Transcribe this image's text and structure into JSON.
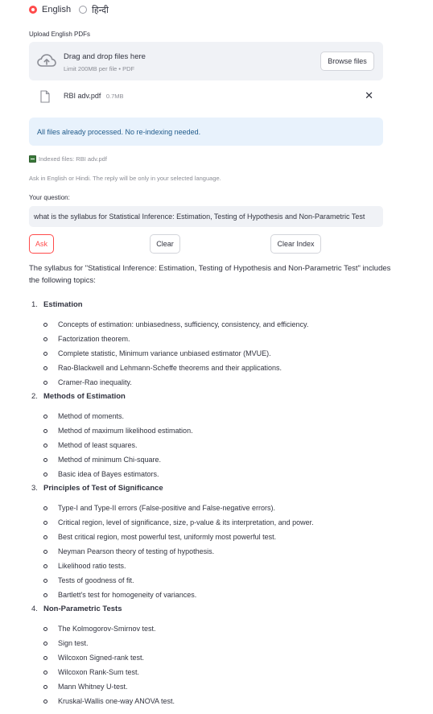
{
  "language": {
    "options": [
      {
        "label": "English",
        "selected": true
      },
      {
        "label": "हिन्दी",
        "selected": false
      }
    ]
  },
  "uploader": {
    "label": "Upload English PDFs",
    "drop_title": "Drag and drop files here",
    "drop_sub": "Limit 200MB per file • PDF",
    "browse_label": "Browse files",
    "file": {
      "name": "RBI adv.pdf",
      "size": "0.7MB"
    },
    "close_glyph": "✕"
  },
  "info": {
    "message": "All files already processed. No re-indexing needed."
  },
  "indexed": {
    "text": "Indexed files: RBI adv.pdf"
  },
  "caption": "Ask in English or Hindi. The reply will be only in your selected language.",
  "question": {
    "label": "Your question:",
    "value": "what is the syllabus for Statistical Inference: Estimation, Testing of Hypothesis and Non-Parametric Test"
  },
  "buttons": {
    "ask": "Ask",
    "clear": "Clear",
    "clear_index": "Clear Index"
  },
  "answer": {
    "intro": "The syllabus for \"Statistical Inference: Estimation, Testing of Hypothesis and Non-Parametric Test\" includes the following topics:",
    "sections": [
      {
        "num": "1.",
        "title": "Estimation",
        "items": [
          "Concepts of estimation: unbiasedness, sufficiency, consistency, and efficiency.",
          "Factorization theorem.",
          "Complete statistic, Minimum variance unbiased estimator (MVUE).",
          "Rao-Blackwell and Lehmann-Scheffe theorems and their applications.",
          "Cramer-Rao inequality."
        ]
      },
      {
        "num": "2.",
        "title": "Methods of Estimation",
        "items": [
          "Method of moments.",
          "Method of maximum likelihood estimation.",
          "Method of least squares.",
          "Method of minimum Chi-square.",
          "Basic idea of Bayes estimators."
        ]
      },
      {
        "num": "3.",
        "title": "Principles of Test of Significance",
        "items": [
          "Type-I and Type-II errors (False-positive and False-negative errors).",
          "Critical region, level of significance, size, p-value & its interpretation, and power.",
          "Best critical region, most powerful test, uniformly most powerful test.",
          "Neyman Pearson theory of testing of hypothesis.",
          "Likelihood ratio tests.",
          "Tests of goodness of fit.",
          "Bartlett's test for homogeneity of variances."
        ]
      },
      {
        "num": "4.",
        "title": "Non-Parametric Tests",
        "items": [
          "The Kolmogorov-Smirnov test.",
          "Sign test.",
          "Wilcoxon Signed-rank test.",
          "Wilcoxon Rank-Sum test.",
          "Mann Whitney U-test.",
          "Kruskal-Wallis one-way ANOVA test."
        ]
      }
    ]
  },
  "colors": {
    "accent": "#ff4b4b",
    "info_bg": "#e8f2fc",
    "info_text": "#1f5a8a",
    "panel": "#f0f2f6"
  },
  "icons": {
    "upload": "cloud-upload-icon",
    "file": "file-icon",
    "close": "close-icon",
    "indexed": "file-cabinet-icon"
  }
}
